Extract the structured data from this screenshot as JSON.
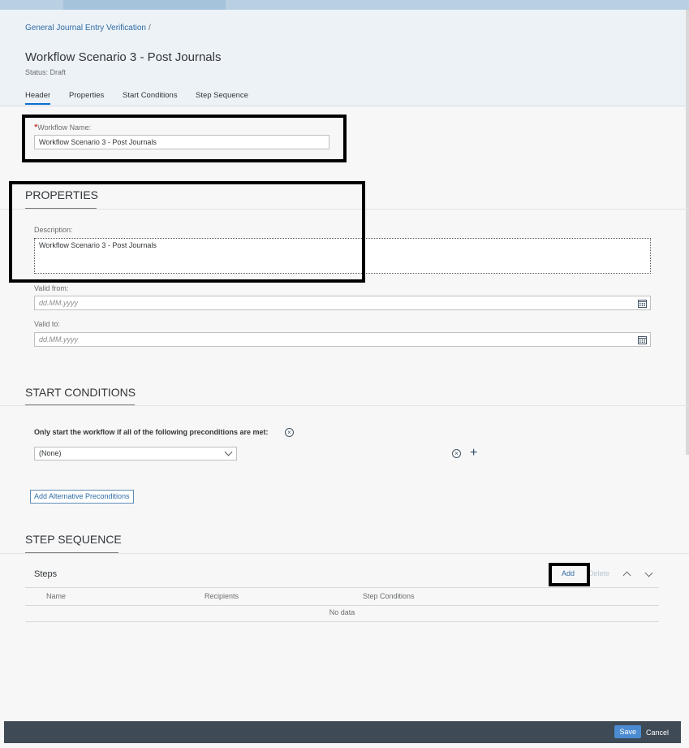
{
  "breadcrumb": {
    "link": "General Journal Entry Verification",
    "separator": "/"
  },
  "header": {
    "title": "Workflow Scenario 3 - Post Journals",
    "status": "Status: Draft",
    "tabs": [
      "Header",
      "Properties",
      "Start Conditions",
      "Step Sequence"
    ],
    "active_tab": "Header"
  },
  "workflow_name": {
    "label": "Workflow Name:",
    "required_mark": "*",
    "value": "Workflow Scenario 3 - Post Journals"
  },
  "properties": {
    "title": "PROPERTIES",
    "description_label": "Description:",
    "description_value": "Workflow Scenario 3 - Post Journals",
    "valid_from_label": "Valid from:",
    "valid_from_placeholder": "dd.MM.yyyy",
    "valid_to_label": "Valid to:",
    "valid_to_placeholder": "dd.MM.yyyy"
  },
  "start_conditions": {
    "title": "START CONDITIONS",
    "precondition_text": "Only start the workflow if all of the following preconditions are met:",
    "select_value": "(None)",
    "add_alt_button": "Add Alternative Preconditions"
  },
  "step_sequence": {
    "title": "STEP SEQUENCE",
    "table_title": "Steps",
    "add_button": "Add",
    "delete_button": "Delete",
    "columns": [
      "Name",
      "Recipients",
      "Step Conditions"
    ],
    "empty_text": "No data"
  },
  "footer": {
    "save": "Save",
    "cancel": "Cancel"
  },
  "colors": {
    "accent": "#0a6ed1",
    "footer_bg": "#3e4a55",
    "save_bg": "#4a8bd1",
    "required": "#bb0000",
    "highlight": "#000000"
  }
}
